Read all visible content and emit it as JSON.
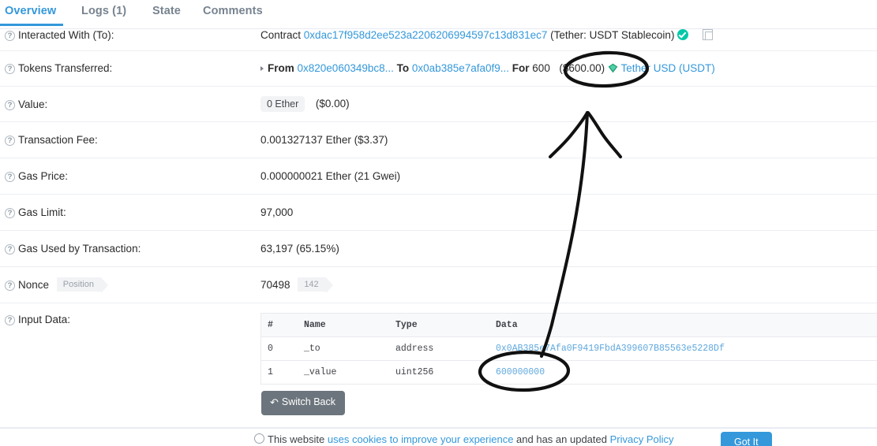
{
  "tabs": [
    {
      "label": "Overview",
      "active": true
    },
    {
      "label": "Logs (1)",
      "active": false
    },
    {
      "label": "State",
      "active": false
    },
    {
      "label": "Comments",
      "active": false
    }
  ],
  "rows": {
    "interacted_with": {
      "label": "Interacted With (To):",
      "prefix": "Contract",
      "address": "0xdac17f958d2ee523a2206206994597c13d831ec7",
      "suffix": "(Tether: USDT Stablecoin)",
      "verified_icon": "verified-check-icon",
      "copy_icon": "copy-icon"
    },
    "tokens_transferred": {
      "label": "Tokens Transferred:",
      "from_label": "From",
      "from_address": "0x820e060349bc8...",
      "to_label": "To",
      "to_address": "0x0ab385e7afa0f9...",
      "for_label": "For",
      "amount": "600",
      "amount_usd": "($600.00)",
      "token_icon": "token-diamond-icon",
      "token_name": "Tether USD (USDT)"
    },
    "value": {
      "label": "Value:",
      "badge": "0 Ether",
      "usd": "($0.00)"
    },
    "transaction_fee": {
      "label": "Transaction Fee:",
      "value": "0.001327137 Ether ($3.37)"
    },
    "gas_price": {
      "label": "Gas Price:",
      "value": "0.000000021 Ether (21 Gwei)"
    },
    "gas_limit": {
      "label": "Gas Limit:",
      "value": "97,000"
    },
    "gas_used": {
      "label": "Gas Used by Transaction:",
      "value": "63,197 (65.15%)"
    },
    "nonce": {
      "label": "Nonce",
      "position_tag": "Position",
      "value": "70498",
      "position_value": "142"
    },
    "input_data": {
      "label": "Input Data:"
    }
  },
  "input_data_table": {
    "headers": [
      "#",
      "Name",
      "Type",
      "Data"
    ],
    "rows": [
      {
        "index": "0",
        "name": "_to",
        "type": "address",
        "data": "0x0AB385e7Afa0F9419FbdA399607B85563e5228Df"
      },
      {
        "index": "1",
        "name": "_value",
        "type": "uint256",
        "data": "600000000"
      }
    ]
  },
  "switch_back_button": {
    "label": "Switch Back",
    "icon": "undo-icon"
  },
  "cookie_bar": {
    "icon": "cookie-icon",
    "text_part1": "This website ",
    "link1": "uses cookies to improve your experience",
    "text_part2": " and has an updated ",
    "link2": "Privacy Policy",
    "button_label": "Got It"
  },
  "annotations": {
    "ellipse_top_target": "($600.00)",
    "ellipse_bottom_target": "600000000",
    "arrow": "arrow-pointing-up-from-600000000-to-600.00"
  },
  "colors": {
    "accent_blue": "#3498db",
    "link_blue": "#3498db",
    "verified_green": "#00c9a7",
    "button_gray": "#6c757d",
    "annotation_black": "#111111"
  }
}
